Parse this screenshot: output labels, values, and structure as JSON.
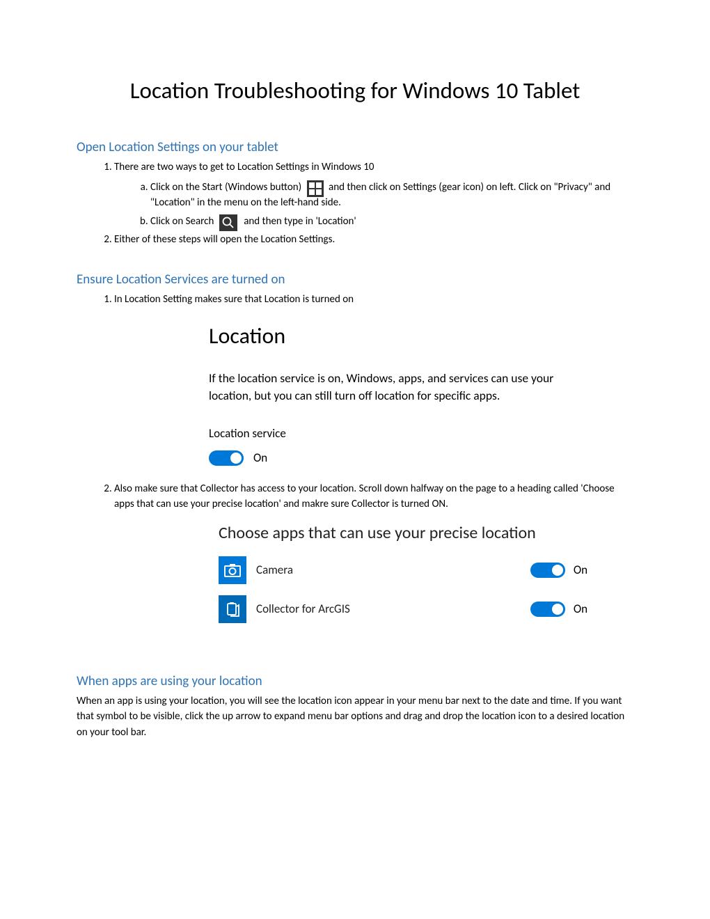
{
  "title": "Location Troubleshooting for Windows 10 Tablet",
  "section1": {
    "heading": "Open Location Settings on your tablet",
    "item1": "There are two ways to get to Location Settings in Windows 10",
    "item1a_pre": "Click on the Start (Windows button) ",
    "item1a_post": " and then click on Settings (gear icon) on left. Click on \"Privacy\" and \"Location\" in the menu on the left-hand side.",
    "item1b_pre": "Click on Search ",
    "item1b_post": " and then type in 'Location'",
    "item2": "Either of these steps will open the Location Settings."
  },
  "section2": {
    "heading": "Ensure Location Services are turned on",
    "item1": "In Location Setting makes sure that Location is turned on",
    "panel": {
      "heading": "Location",
      "desc": "If the location service is on, Windows, apps, and services can use your location, but you can still turn off location for specific apps.",
      "sub": "Location service",
      "toggle_state": "On"
    },
    "item2": "Also make sure that Collector has access to your location. Scroll down halfway on the page to a heading called 'Choose apps that can use your precise location' and makre sure Collector is turned ON.",
    "apps_panel": {
      "heading": "Choose apps that can use your precise location",
      "rows": [
        {
          "name": "Camera",
          "state": "On",
          "icon": "camera"
        },
        {
          "name": "Collector for ArcGIS",
          "state": "On",
          "icon": "collector"
        }
      ]
    }
  },
  "section3": {
    "heading": "When apps are using your location",
    "body": "When an app is using your location, you will see the location icon appear in your menu bar next to the date and time. If you want that symbol to be visible, click the up arrow to expand menu bar options and drag and drop the location icon to a desired location on your tool bar."
  }
}
